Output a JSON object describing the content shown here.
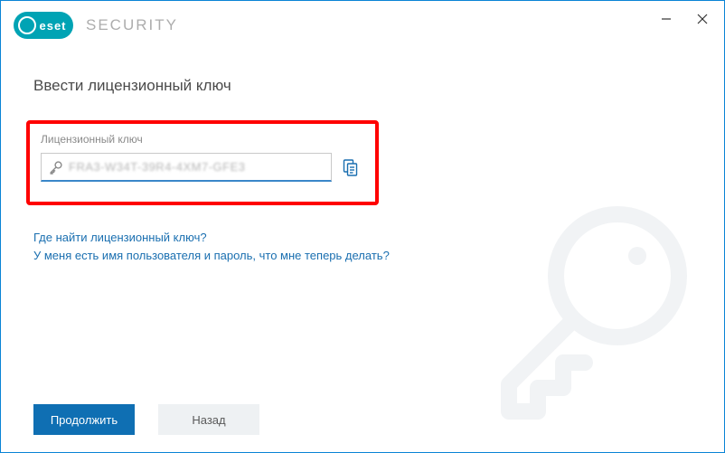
{
  "brand": {
    "logo_text": "eset",
    "product": "SECURITY"
  },
  "page": {
    "title": "Ввести лицензионный ключ"
  },
  "license": {
    "field_label": "Лицензионный ключ",
    "value": "FRA3-W34T-39R4-4XM7-GFE3"
  },
  "links": {
    "where_find": "Где найти лицензионный ключ?",
    "have_credentials": "У меня есть имя пользователя и пароль, что мне теперь делать?"
  },
  "buttons": {
    "continue": "Продолжить",
    "back": "Назад"
  }
}
